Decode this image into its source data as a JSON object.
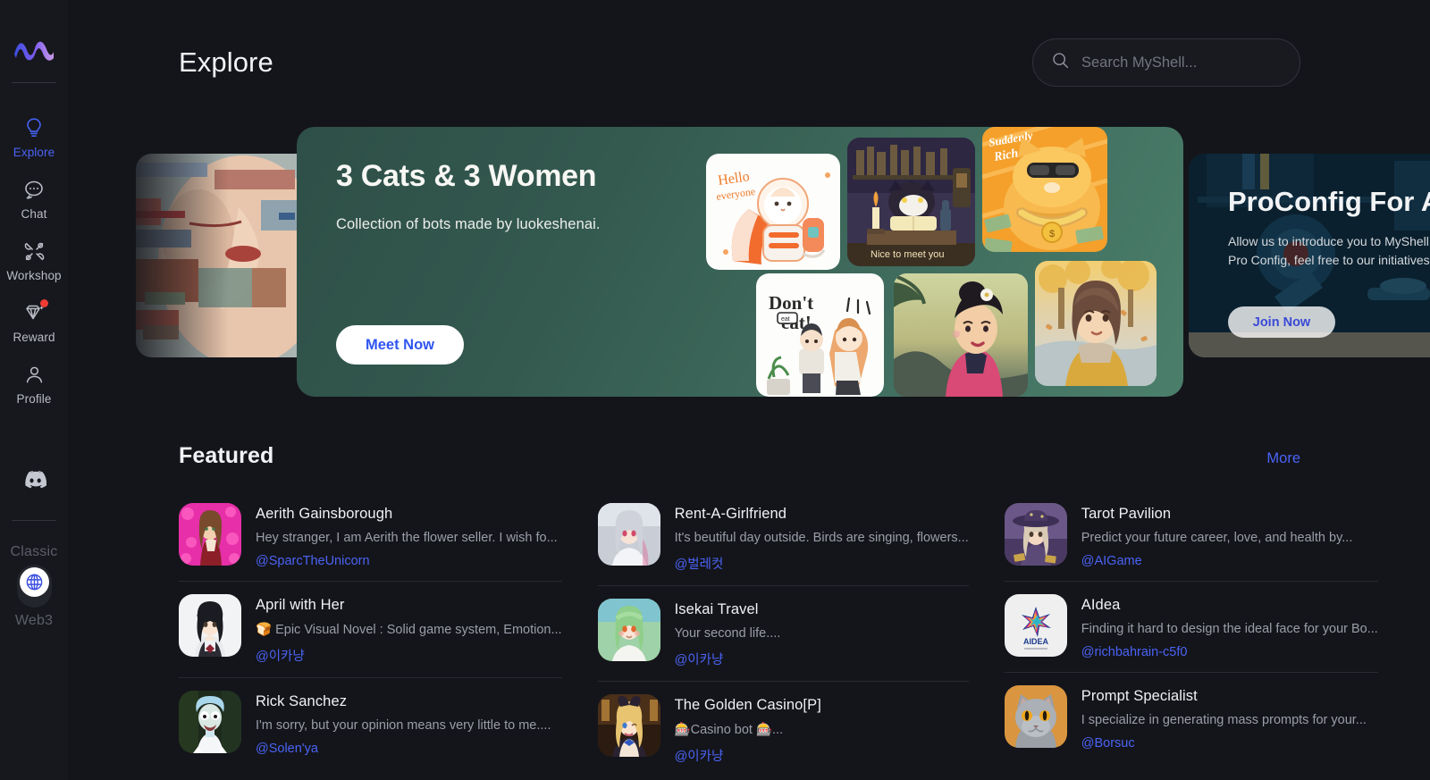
{
  "sidebar": {
    "logo_name": "myshell-logo",
    "nav": [
      {
        "label": "Explore",
        "icon": "lightbulb-icon",
        "active": true,
        "badge": false
      },
      {
        "label": "Chat",
        "icon": "chat-bubble-icon",
        "active": false,
        "badge": false
      },
      {
        "label": "Workshop",
        "icon": "tools-icon",
        "active": false,
        "badge": false
      },
      {
        "label": "Reward",
        "icon": "diamond-icon",
        "active": false,
        "badge": true
      },
      {
        "label": "Profile",
        "icon": "user-icon",
        "active": false,
        "badge": false
      }
    ],
    "discord_icon": "discord-icon",
    "mode_toggle": {
      "top_label": "Classic",
      "bottom_label": "Web3",
      "knob_icon": "globe-icon",
      "state": "web3"
    }
  },
  "header": {
    "title": "Explore",
    "search": {
      "placeholder": "Search MyShell...",
      "value": "",
      "icon": "search-icon"
    }
  },
  "carousel": {
    "prev_slide": {
      "alt": "glitch-portrait-artwork"
    },
    "active_slide": {
      "title": "3 Cats & 3 Women",
      "subtitle": "Collection of bots made by luokeshenai.",
      "button": "Meet Now",
      "accent": "#3e6a5c",
      "stickers": [
        {
          "name": "astronaut-cat-sticker",
          "caption": "Hello everyone"
        },
        {
          "name": "witch-cat-sticker",
          "caption": "Nice to meet you"
        },
        {
          "name": "rich-cat-sticker",
          "caption": "Suddenly Rich"
        },
        {
          "name": "dont-eat-sticker",
          "caption": "Don't eat!"
        },
        {
          "name": "mulan-woman-sticker",
          "caption": ""
        },
        {
          "name": "autumn-woman-sticker",
          "caption": ""
        }
      ]
    },
    "next_slide": {
      "title": "ProConfig For A",
      "description": "Allow us to introduce you to MyShell creating bots: Pro Config, feel free to our initiatives!",
      "button": "Join Now"
    }
  },
  "featured": {
    "title": "Featured",
    "more_label": "More",
    "columns": [
      [
        {
          "name": "Aerith Gainsborough",
          "desc": "Hey stranger, I am Aerith the flower seller. I wish fo...",
          "author": "@SparcTheUnicorn",
          "avatar": "aerith-avatar"
        },
        {
          "name": "April with Her",
          "desc": "🍞 Epic Visual Novel : Solid game system, Emotion...",
          "author": "@이카냥",
          "avatar": "april-avatar"
        },
        {
          "name": "Rick Sanchez",
          "desc": "I'm sorry, but your opinion means very little to me....",
          "author": "@Solen'ya",
          "avatar": "rick-avatar"
        }
      ],
      [
        {
          "name": "Rent-A-Girlfriend",
          "desc": "It's beutiful day outside. Birds are singing, flowers...",
          "author": "@벌레컷",
          "avatar": "rent-a-girlfriend-avatar"
        },
        {
          "name": "Isekai Travel",
          "desc": "Your second life....",
          "author": "@이카냥",
          "avatar": "isekai-avatar"
        },
        {
          "name": "The Golden Casino[P]",
          "desc": "🎰Casino bot 🎰...",
          "author": "@이카냥",
          "avatar": "golden-casino-avatar"
        }
      ],
      [
        {
          "name": "Tarot Pavilion",
          "desc": "Predict your future career, love, and health by...",
          "author": "@AIGame",
          "avatar": "tarot-avatar"
        },
        {
          "name": "AIdea",
          "desc": "Finding it hard to design the ideal face for your Bo...",
          "author": "@richbahrain-c5f0",
          "avatar": "aidea-avatar"
        },
        {
          "name": "Prompt Specialist",
          "desc": "I specialize in generating mass prompts for your...",
          "author": "@Borsuc",
          "avatar": "prompt-specialist-avatar"
        }
      ]
    ]
  }
}
